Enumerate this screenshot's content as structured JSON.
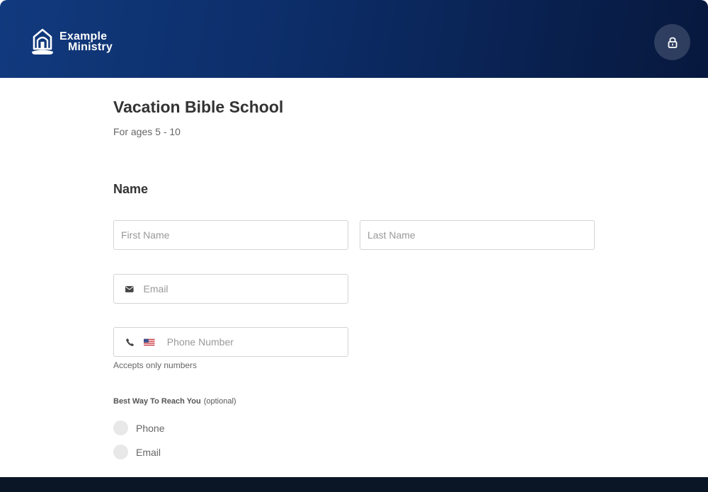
{
  "header": {
    "logo_line1": "Example",
    "logo_line2": "Ministry",
    "logo_icon": "church-icon",
    "lock_icon": "lock-icon",
    "gradient_start": "#113a7e",
    "gradient_end": "#07183d"
  },
  "form": {
    "title": "Vacation Bible School",
    "subtitle": "For ages 5 - 10",
    "name_section": "Name",
    "first_name_placeholder": "First Name",
    "last_name_placeholder": "Last Name",
    "email_placeholder": "Email",
    "email_icon": "envelope-icon",
    "phone_placeholder": "Phone Number",
    "phone_icon": "phone-icon",
    "flag_icon": "us-flag-icon",
    "phone_hint": "Accepts only numbers",
    "reach_label": "Best Way To Reach You",
    "reach_optional": "(optional)",
    "reach_options": [
      {
        "label": "Phone",
        "selected": false
      },
      {
        "label": "Email",
        "selected": false
      }
    ]
  },
  "colors": {
    "footer": "#0a1526",
    "radio_bg": "#e8e8e8"
  }
}
